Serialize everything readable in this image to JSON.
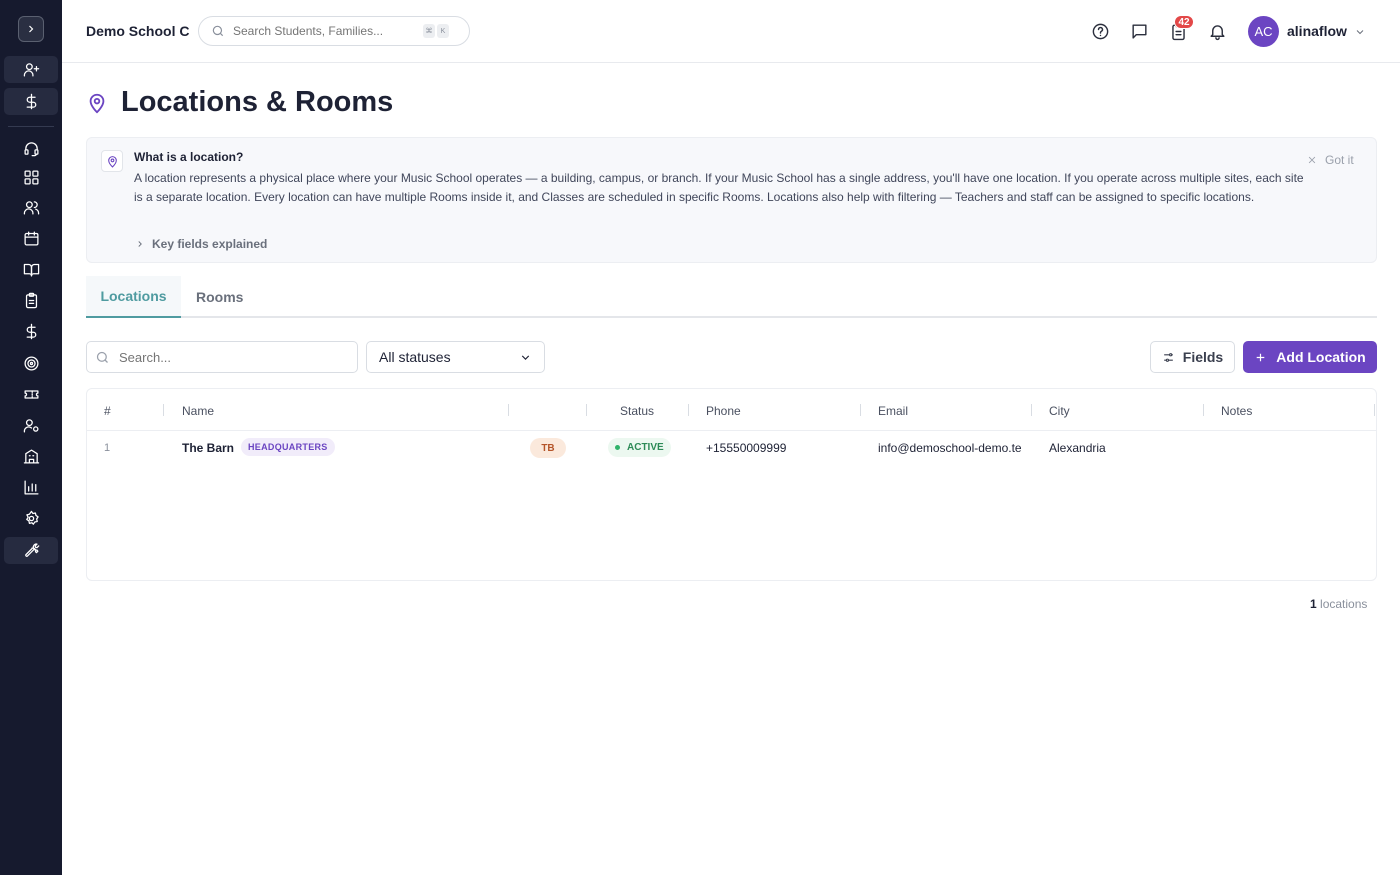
{
  "header": {
    "school_name": "Demo School C",
    "search_placeholder": "Search Students, Families...",
    "kbd_keys": [
      "⌘",
      "K"
    ],
    "notification_count": "42",
    "avatar_initials": "AC",
    "username": "alinaflow"
  },
  "sidebar": {
    "items": [
      {
        "icon": "user-plus-icon"
      },
      {
        "icon": "dollar-icon"
      },
      {
        "icon": "headset-icon"
      },
      {
        "icon": "dashboard-icon"
      },
      {
        "icon": "users-icon"
      },
      {
        "icon": "calendar-icon"
      },
      {
        "icon": "book-icon"
      },
      {
        "icon": "clipboard-icon"
      },
      {
        "icon": "dollar-icon"
      },
      {
        "icon": "target-icon"
      },
      {
        "icon": "ticket-icon"
      },
      {
        "icon": "user-settings-icon"
      },
      {
        "icon": "building-icon"
      },
      {
        "icon": "bar-chart-icon"
      },
      {
        "icon": "gear-icon"
      },
      {
        "icon": "wrench-icon"
      }
    ]
  },
  "page": {
    "title": "Locations & Rooms"
  },
  "info": {
    "title": "What is a location?",
    "text": "A location represents a physical place where your Music School operates — a building, campus, or branch. If your Music School has a single address, you'll have one location. If you operate across multiple sites, each site is a separate location. Every location can have multiple Rooms inside it, and Classes are scheduled in specific Rooms. Locations also help with filtering — Teachers and staff can be assigned to specific locations.",
    "dismiss_label": "Got it",
    "key_fields_label": "Key fields explained"
  },
  "tabs": [
    {
      "label": "Locations",
      "active": true
    },
    {
      "label": "Rooms",
      "active": false
    }
  ],
  "toolbar": {
    "search_placeholder": "Search...",
    "status_filter": "All statuses",
    "fields_label": "Fields",
    "add_label": "Add Location"
  },
  "table": {
    "columns": [
      "#",
      "Name",
      "",
      "Status",
      "Phone",
      "Email",
      "City",
      "Notes"
    ],
    "rows": [
      {
        "num": "1",
        "name": "The Barn",
        "tag": "HEADQUARTERS",
        "initials": "TB",
        "status": "ACTIVE",
        "phone": "+15550009999",
        "email": "info@demoschool-demo.te",
        "city": "Alexandria",
        "notes": ""
      }
    ]
  },
  "footer": {
    "count": "1",
    "count_label": "locations"
  },
  "colors": {
    "sidebar_bg": "#161a2e",
    "accent_purple": "#6b45c2",
    "tab_active": "#4f9ba0",
    "status_active": "#2fb36a",
    "badge_red": "#e34848"
  }
}
